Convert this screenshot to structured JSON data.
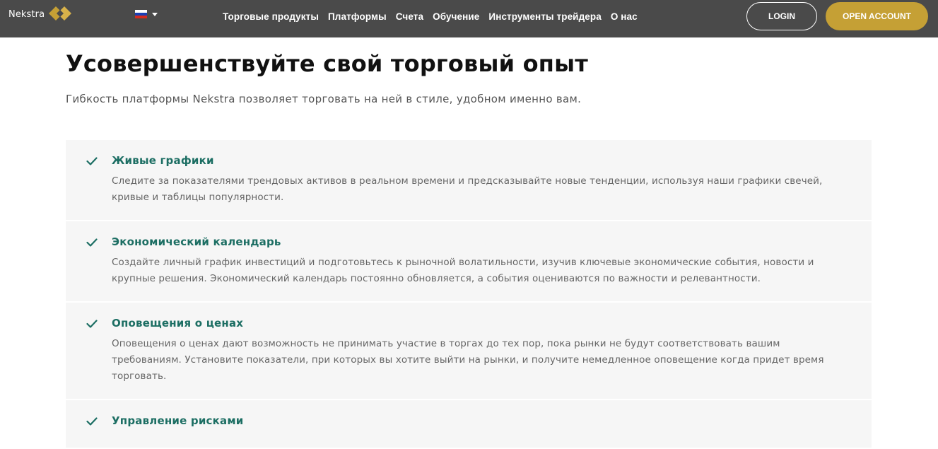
{
  "header": {
    "logo_text": "Nekstra",
    "nav": [
      "Торговые продукты",
      "Платформы",
      "Счета",
      "Обучение",
      "Инструменты трейдера",
      "О нас"
    ],
    "login_label": "LOGIN",
    "open_account_label": "OPEN ACCOUNT",
    "language_icon": "russian-flag-icon"
  },
  "colors": {
    "topbar": "#4a4a4a",
    "accent_gold": "#c5a035",
    "feature_title": "#1c6e63",
    "check": "#1c6e63"
  },
  "main": {
    "headline": "Усовершенствуйте свой торговый опыт",
    "subhead": "Гибкость платформы Nekstra позволяет торговать на ней в стиле, удобном именно вам.",
    "features": [
      {
        "title": "Живые графики",
        "desc": "Следите за показателями трендовых активов в реальном времени и предсказывайте новые тенденции, используя наши графики свечей, кривые и таблицы популярности."
      },
      {
        "title": "Экономический календарь",
        "desc": "Создайте личный график инвестиций и подготовьтесь к рыночной волатильности, изучив ключевые экономические события, новости и крупные решения. Экономический календарь постоянно обновляется, а события оцениваются по важности и релевантности."
      },
      {
        "title": "Оповещения о ценах",
        "desc": "Оповещения о ценах дают возможность не принимать участие в торгах до тех пор, пока рынки не будут соответствовать вашим требованиям. Установите показатели, при которых вы хотите выйти на рынки, и получите немедленное оповещение когда придет время торговать."
      },
      {
        "title": "Управление рисками",
        "desc": ""
      }
    ]
  }
}
